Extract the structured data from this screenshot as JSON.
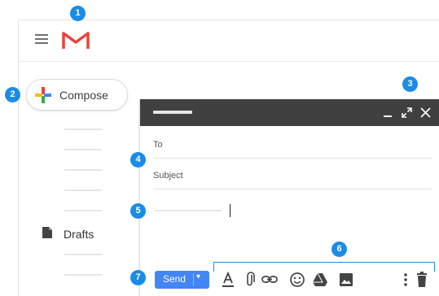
{
  "callouts": [
    "1",
    "2",
    "3",
    "4",
    "5",
    "6",
    "7"
  ],
  "sidebar": {
    "compose_label": "Compose",
    "drafts_label": "Drafts"
  },
  "compose_window": {
    "to_label": "To",
    "subject_label": "Subject",
    "send_label": "Send",
    "send_arrow": "▾"
  },
  "icons": {
    "menu": "hamburger-icon",
    "logo": "gmail-logo",
    "minimize": "minimize-icon",
    "expand": "expand-icon",
    "close": "close-icon",
    "drafts": "document-icon",
    "toolbar": [
      "text-format-icon",
      "attach-icon",
      "link-icon",
      "emoji-icon",
      "drive-icon",
      "photo-icon",
      "more-options-icon",
      "trash-icon"
    ]
  },
  "colors": {
    "callout": "#1a8ce8",
    "send": "#4285f4",
    "header": "#404040",
    "logo_red": "#ea4335"
  }
}
